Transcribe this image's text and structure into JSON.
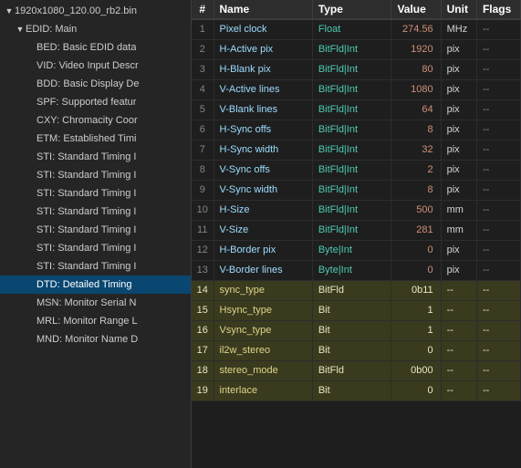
{
  "tree": {
    "items": [
      {
        "id": "root",
        "label": "1920x1080_120.00_rb2.bin",
        "indent": 1,
        "arrow": "▼",
        "selected": false
      },
      {
        "id": "edid-main",
        "label": "EDID: Main",
        "indent": 2,
        "arrow": "▼",
        "selected": false
      },
      {
        "id": "bed",
        "label": "BED: Basic EDID data",
        "indent": 3,
        "arrow": "",
        "selected": false
      },
      {
        "id": "vid",
        "label": "VID: Video Input Descr",
        "indent": 3,
        "arrow": "",
        "selected": false
      },
      {
        "id": "bdd",
        "label": "BDD: Basic Display De",
        "indent": 3,
        "arrow": "",
        "selected": false
      },
      {
        "id": "spf",
        "label": "SPF: Supported featur",
        "indent": 3,
        "arrow": "",
        "selected": false
      },
      {
        "id": "cxy",
        "label": "CXY: Chromacity Coor",
        "indent": 3,
        "arrow": "",
        "selected": false
      },
      {
        "id": "etm",
        "label": "ETM: Established Timi",
        "indent": 3,
        "arrow": "",
        "selected": false
      },
      {
        "id": "sti1",
        "label": "STI: Standard Timing I",
        "indent": 3,
        "arrow": "",
        "selected": false
      },
      {
        "id": "sti2",
        "label": "STI: Standard Timing I",
        "indent": 3,
        "arrow": "",
        "selected": false
      },
      {
        "id": "sti3",
        "label": "STI: Standard Timing I",
        "indent": 3,
        "arrow": "",
        "selected": false
      },
      {
        "id": "sti4",
        "label": "STI: Standard Timing I",
        "indent": 3,
        "arrow": "",
        "selected": false
      },
      {
        "id": "sti5",
        "label": "STI: Standard Timing I",
        "indent": 3,
        "arrow": "",
        "selected": false
      },
      {
        "id": "sti6",
        "label": "STI: Standard Timing I",
        "indent": 3,
        "arrow": "",
        "selected": false
      },
      {
        "id": "sti7",
        "label": "STI: Standard Timing I",
        "indent": 3,
        "arrow": "",
        "selected": false
      },
      {
        "id": "dtd",
        "label": "DTD: Detailed Timing",
        "indent": 3,
        "arrow": "",
        "selected": true
      },
      {
        "id": "msn",
        "label": "MSN: Monitor Serial N",
        "indent": 3,
        "arrow": "",
        "selected": false
      },
      {
        "id": "mrl",
        "label": "MRL: Monitor Range L",
        "indent": 3,
        "arrow": "",
        "selected": false
      },
      {
        "id": "mnd",
        "label": "MND: Monitor Name D",
        "indent": 3,
        "arrow": "",
        "selected": false
      }
    ]
  },
  "table": {
    "headers": {
      "num": "#",
      "name": "Name",
      "type": "Type",
      "value": "Value",
      "unit": "Unit",
      "flags": "Flags"
    },
    "rows": [
      {
        "num": "1",
        "name": "Pixel clock",
        "type": "Float",
        "value": "274.56",
        "unit": "MHz",
        "flags": "--",
        "highlight": false
      },
      {
        "num": "2",
        "name": "H-Active pix",
        "type": "BitFld|Int",
        "value": "1920",
        "unit": "pix",
        "flags": "--",
        "highlight": false
      },
      {
        "num": "3",
        "name": "H-Blank pix",
        "type": "BitFld|Int",
        "value": "80",
        "unit": "pix",
        "flags": "--",
        "highlight": false
      },
      {
        "num": "4",
        "name": "V-Active lines",
        "type": "BitFld|Int",
        "value": "1080",
        "unit": "pix",
        "flags": "--",
        "highlight": false
      },
      {
        "num": "5",
        "name": "V-Blank lines",
        "type": "BitFld|Int",
        "value": "64",
        "unit": "pix",
        "flags": "--",
        "highlight": false
      },
      {
        "num": "6",
        "name": "H-Sync offs",
        "type": "BitFld|Int",
        "value": "8",
        "unit": "pix",
        "flags": "--",
        "highlight": false
      },
      {
        "num": "7",
        "name": "H-Sync width",
        "type": "BitFld|Int",
        "value": "32",
        "unit": "pix",
        "flags": "--",
        "highlight": false
      },
      {
        "num": "8",
        "name": "V-Sync offs",
        "type": "BitFld|Int",
        "value": "2",
        "unit": "pix",
        "flags": "--",
        "highlight": false
      },
      {
        "num": "9",
        "name": "V-Sync width",
        "type": "BitFld|Int",
        "value": "8",
        "unit": "pix",
        "flags": "--",
        "highlight": false
      },
      {
        "num": "10",
        "name": "H-Size",
        "type": "BitFld|Int",
        "value": "500",
        "unit": "mm",
        "flags": "--",
        "highlight": false
      },
      {
        "num": "11",
        "name": "V-Size",
        "type": "BitFld|Int",
        "value": "281",
        "unit": "mm",
        "flags": "--",
        "highlight": false
      },
      {
        "num": "12",
        "name": "H-Border pix",
        "type": "Byte|Int",
        "value": "0",
        "unit": "pix",
        "flags": "--",
        "highlight": false
      },
      {
        "num": "13",
        "name": "V-Border lines",
        "type": "Byte|Int",
        "value": "0",
        "unit": "pix",
        "flags": "--",
        "highlight": false
      },
      {
        "num": "14",
        "name": "sync_type",
        "type": "BitFld",
        "value": "0b11",
        "unit": "--",
        "flags": "--",
        "highlight": true
      },
      {
        "num": "15",
        "name": "Hsync_type",
        "type": "Bit",
        "value": "1",
        "unit": "--",
        "flags": "--",
        "highlight": true
      },
      {
        "num": "16",
        "name": "Vsync_type",
        "type": "Bit",
        "value": "1",
        "unit": "--",
        "flags": "--",
        "highlight": true
      },
      {
        "num": "17",
        "name": "il2w_stereo",
        "type": "Bit",
        "value": "0",
        "unit": "--",
        "flags": "--",
        "highlight": true
      },
      {
        "num": "18",
        "name": "stereo_mode",
        "type": "BitFld",
        "value": "0b00",
        "unit": "--",
        "flags": "--",
        "highlight": true
      },
      {
        "num": "19",
        "name": "interlace",
        "type": "Bit",
        "value": "0",
        "unit": "--",
        "flags": "--",
        "highlight": true
      }
    ]
  }
}
